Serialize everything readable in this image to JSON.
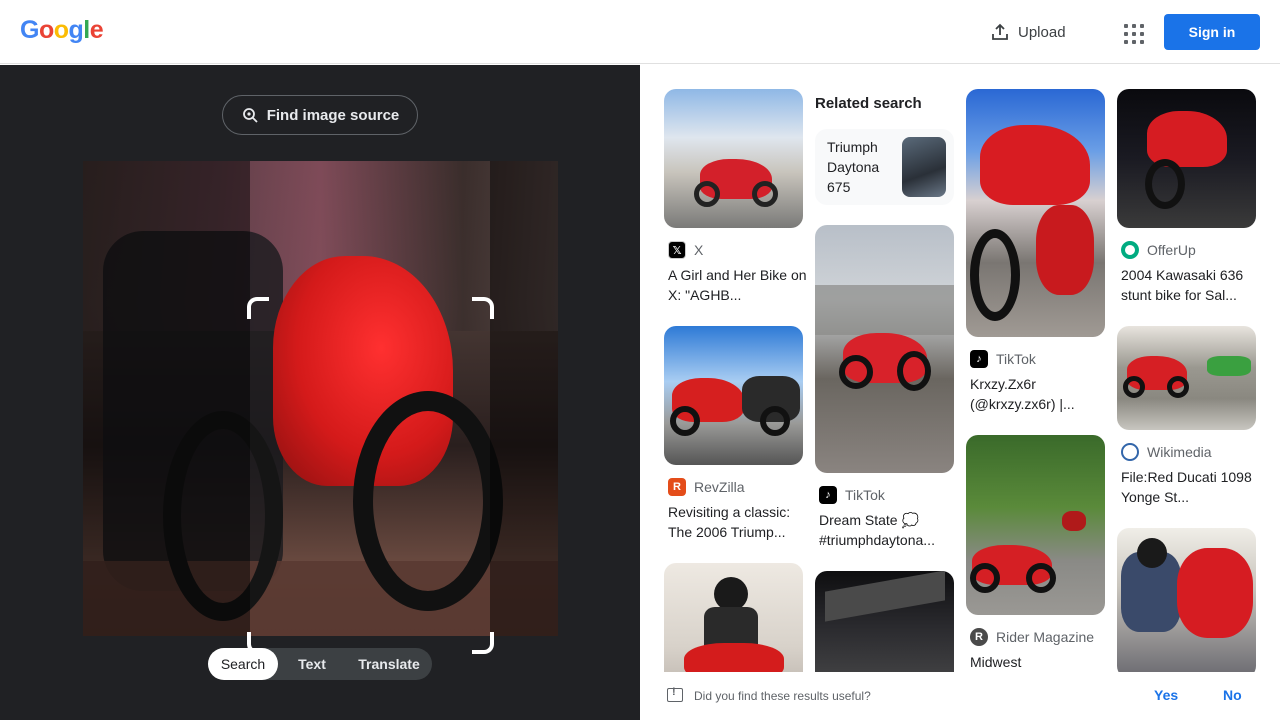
{
  "header": {
    "logo_text": "Google",
    "upload_label": "Upload",
    "apps_icon": "apps-grid-icon",
    "signin_label": "Sign in"
  },
  "lens": {
    "find_source_label": "Find image source",
    "modes": [
      {
        "label": "Search",
        "active": true
      },
      {
        "label": "Text",
        "active": false
      },
      {
        "label": "Translate",
        "active": false
      }
    ]
  },
  "related": {
    "heading": "Related search",
    "items": [
      {
        "label": "Triumph Daytona 675"
      }
    ]
  },
  "results": [
    {
      "source": "X",
      "title": "A Girl and Her Bike on X: \"AGHB..."
    },
    {
      "source": "RevZilla",
      "title": "Revisiting a classic: The 2006 Triump..."
    },
    {
      "source": "TikTok",
      "title": "Dream State 💭 #triumphdaytona..."
    },
    {
      "source": "TikTok",
      "title": "Krxzy.Zx6r (@krxzy.zx6r) |..."
    },
    {
      "source": "Rider Magazine",
      "title": "Midwest"
    },
    {
      "source": "OfferUp",
      "title": "2004 Kawasaki 636 stunt bike for Sal..."
    },
    {
      "source": "Wikimedia",
      "title": "File:Red Ducati 1098 Yonge St..."
    }
  ],
  "feedback": {
    "question": "Did you find these results useful?",
    "yes_label": "Yes",
    "no_label": "No"
  },
  "colors": {
    "accent": "#1a73e8",
    "dark_panel": "#202124"
  }
}
